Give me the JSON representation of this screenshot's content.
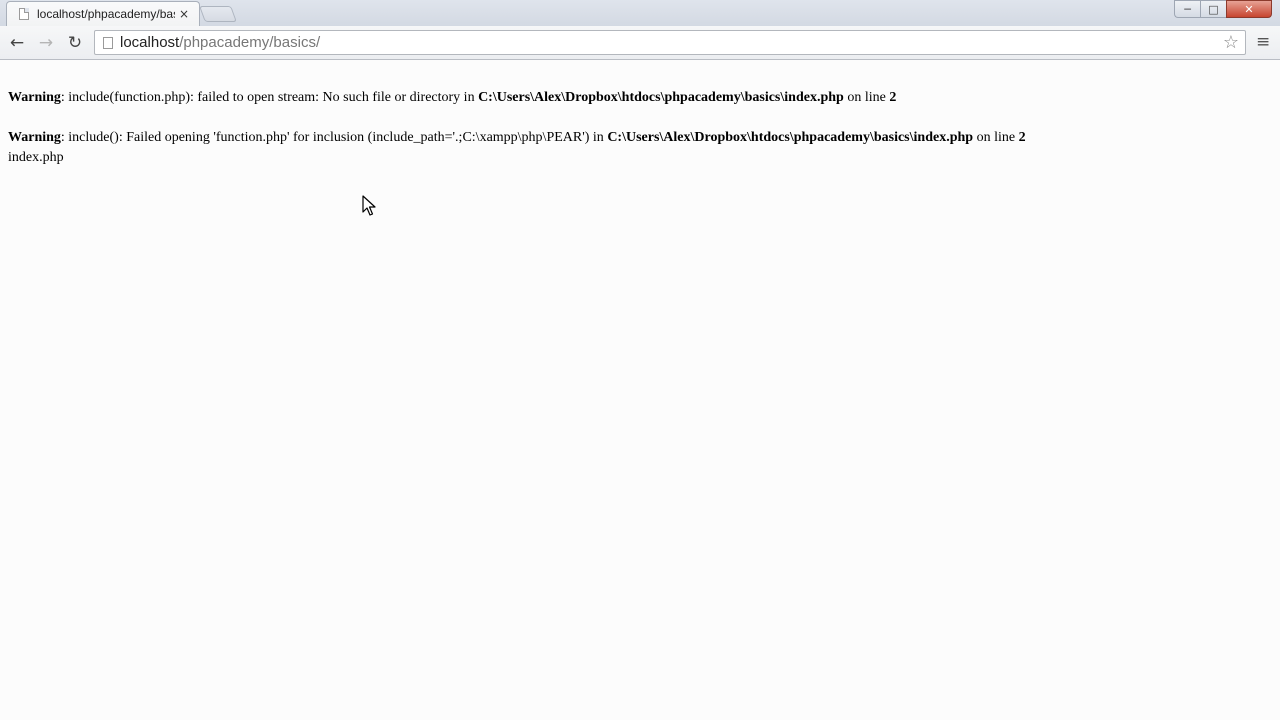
{
  "browser": {
    "tab": {
      "title": "localhost/phpacademy/basics/",
      "close_glyph": "×"
    },
    "window_controls": {
      "minimize": "─",
      "maximize": "□",
      "close": "✕"
    },
    "nav": {
      "back": "←",
      "forward": "→",
      "reload": "↻"
    },
    "address": {
      "host": "localhost",
      "path": "/phpacademy/basics/"
    },
    "star_glyph": "☆",
    "menu_glyph": "≡"
  },
  "page": {
    "warnings": [
      {
        "label": "Warning",
        "message": ": include(function.php): failed to open stream: No such file or directory in ",
        "file": "C:\\Users\\Alex\\Dropbox\\htdocs\\phpacademy\\basics\\index.php",
        "line_text": " on line ",
        "line": "2"
      },
      {
        "label": "Warning",
        "message": ": include(): Failed opening 'function.php' for inclusion (include_path='.;C:\\xampp\\php\\PEAR') in ",
        "file": "C:\\Users\\Alex\\Dropbox\\htdocs\\phpacademy\\basics\\index.php",
        "line_text": " on line ",
        "line": "2"
      }
    ],
    "output": "index.php"
  }
}
